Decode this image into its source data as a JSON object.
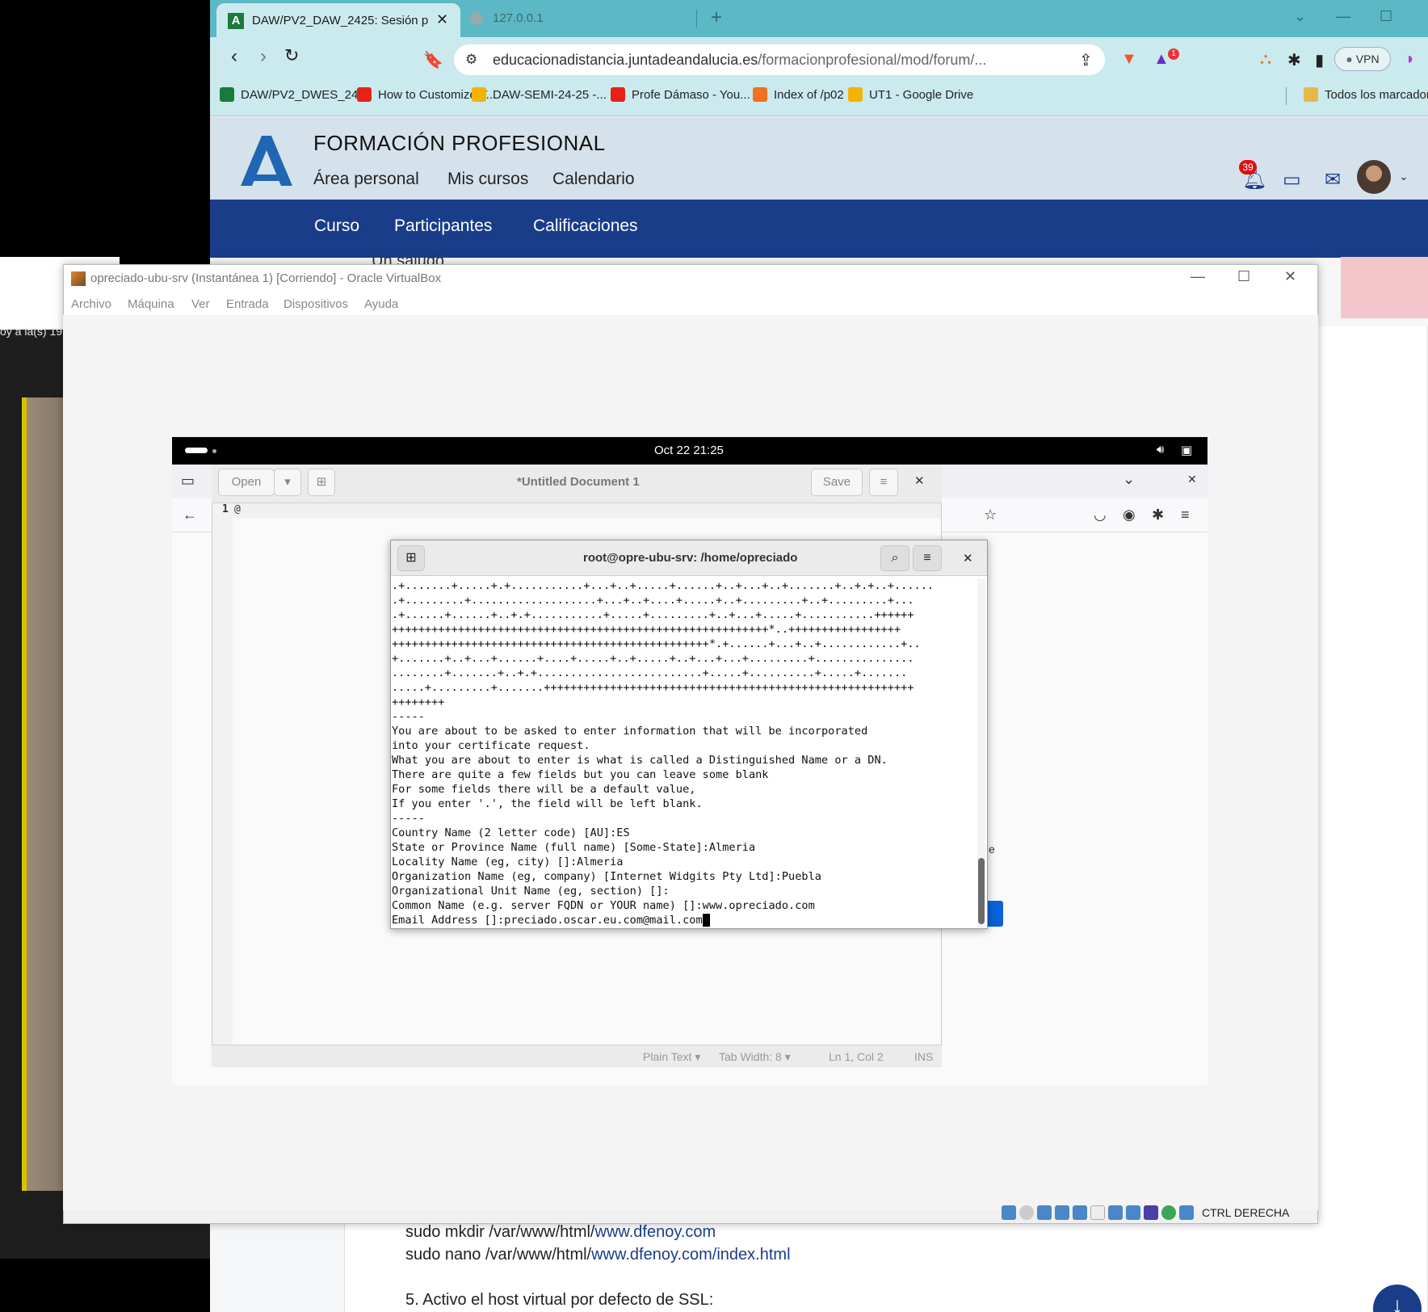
{
  "left_bg_text": "oy a la(s) 19:",
  "browser": {
    "tabs": [
      {
        "title": "DAW/PV2_DAW_2425: Sesión p",
        "favicon": "A"
      },
      {
        "title": "127.0.0.1"
      }
    ],
    "url_host": "educacionadistancia.juntadeandalucia.es",
    "url_path": "/formacionprofesional/mod/forum/...",
    "vpn_label": "VPN",
    "brave_badge": "1",
    "bookmarks": [
      {
        "label": "DAW/PV2_DWES_24...",
        "icon": "andalucia-icon",
        "color": "#1b7a3d"
      },
      {
        "label": "How to Customize Y...",
        "icon": "youtube-icon",
        "color": "#e62117"
      },
      {
        "label": "DAW-SEMI-24-25 -...",
        "icon": "google-drive-icon",
        "color": "#f2b400"
      },
      {
        "label": "Profe Dámaso - You...",
        "icon": "youtube-icon",
        "color": "#e62117"
      },
      {
        "label": "Index of /p02",
        "icon": "xampp-icon",
        "color": "#f36f21"
      },
      {
        "label": "UT1 - Google Drive",
        "icon": "google-drive-icon",
        "color": "#f2b400"
      }
    ],
    "bookmarks_all": "Todos los marcador"
  },
  "moodle": {
    "site_name": "FORMACIÓN PROFESIONAL",
    "nav": [
      "Área personal",
      "Mis cursos",
      "Calendario"
    ],
    "notif_count": "39",
    "course_nav": [
      "Curso",
      "Participantes",
      "Calificaciones"
    ],
    "partial_text": "Un saludo",
    "content_lines": [
      {
        "prefix": "sudo mkdir /var/www/html/",
        "link": "www.dfenoy.com",
        "suffix": ""
      },
      {
        "prefix": "sudo nano /var/www/html/",
        "link": "www.dfenoy.com/index.html",
        "suffix": ""
      },
      {
        "prefix": "5. Activo el host virtual por defecto de SSL:",
        "link": "",
        "suffix": ""
      }
    ]
  },
  "vbox": {
    "title": "opreciado-ubu-srv (Instantánea 1) [Corriendo] - Oracle VirtualBox",
    "menu": [
      "Archivo",
      "Máquina",
      "Ver",
      "Entrada",
      "Dispositivos",
      "Ayuda"
    ],
    "host_key": "CTRL DERECHA"
  },
  "ubuntu": {
    "clock": "Oct 22  21:25"
  },
  "gedit": {
    "open_label": "Open",
    "title": "*Untitled Document 1",
    "save_label": "Save",
    "line_number": "1",
    "content": "@",
    "status": {
      "lang": "Plain Text",
      "tab": "Tab Width: 8",
      "pos": "Ln 1, Col 2",
      "mode": "INS"
    }
  },
  "terminal": {
    "title": "root@opre-ubu-srv: /home/opreciado",
    "lines": [
      ".+.......+.....+.+...........+...+..+.....+......+..+...+..+.......+..+.+..+......",
      ".+.........+...................+...+..+....+.....+..+.........+..+.........+...",
      ".+......+......+..+.+...........+.....+.........+..+...+.....+...........++++++",
      "+++++++++++++++++++++++++++++++++++++++++++++++++++++++++*..+++++++++++++++++",
      "++++++++++++++++++++++++++++++++++++++++++++++++*.+......+...+..+............+..",
      "+.......+..+...+......+....+.....+..+.....+..+...+...+.........+...............",
      "........+.......+..+.+.........................+.....+..........+.....+.......",
      ".....+.........+.......++++++++++++++++++++++++++++++++++++++++++++++++++++++++",
      "++++++++",
      "-----",
      "You are about to be asked to enter information that will be incorporated",
      "into your certificate request.",
      "What you are about to enter is what is called a Distinguished Name or a DN.",
      "There are quite a few fields but you can leave some blank",
      "For some fields there will be a default value,",
      "If you enter '.', the field will be left blank.",
      "-----",
      "Country Name (2 letter code) [AU]:ES",
      "State or Province Name (full name) [Some-State]:Almeria",
      "Locality Name (eg, city) []:Almeria",
      "Organization Name (eg, company) [Internet Widgits Pty Ltd]:Puebla",
      "Organizational Unit Name (eg, section) []:",
      "Common Name (e.g. server FQDN or YOUR name) []:www.opreciado.com",
      "Email Address []:preciado.oscar.eu.com@mail.com"
    ]
  }
}
